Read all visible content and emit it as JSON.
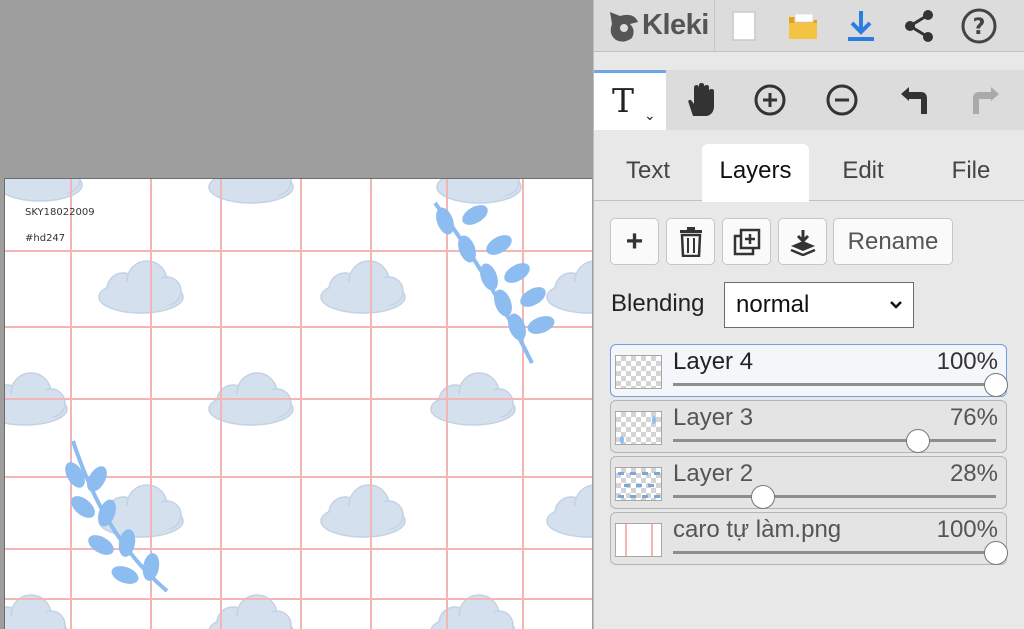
{
  "app": {
    "name": "Kleki"
  },
  "canvas": {
    "texts": [
      "SKY18022009",
      "#hd247"
    ]
  },
  "topbar": {
    "buttons": [
      "new-image",
      "open-file",
      "download",
      "share",
      "help"
    ]
  },
  "toolbar": {
    "active_tool_glyph": "T",
    "tools": [
      "text-tool",
      "hand-tool",
      "zoom-in",
      "zoom-out",
      "undo",
      "redo"
    ]
  },
  "tabs": [
    {
      "label": "Text",
      "active": false
    },
    {
      "label": "Layers",
      "active": true
    },
    {
      "label": "Edit",
      "active": false
    },
    {
      "label": "File",
      "active": false
    }
  ],
  "layer_actions": {
    "add": "+",
    "rename_label": "Rename"
  },
  "blending": {
    "label": "Blending",
    "value": "normal"
  },
  "layers": [
    {
      "name": "Layer 4",
      "opacity_label": "100%",
      "opacity": 1.0,
      "active": true
    },
    {
      "name": "Layer 3",
      "opacity_label": "76%",
      "opacity": 0.76,
      "active": false
    },
    {
      "name": "Layer 2",
      "opacity_label": "28%",
      "opacity": 0.28,
      "active": false
    },
    {
      "name": "caro tự làm.png",
      "opacity_label": "100%",
      "opacity": 1.0,
      "active": false
    }
  ],
  "colors": {
    "accent": "#2a7de1",
    "folder": "#f3b91d",
    "leaf": "#8cbcf0",
    "grid": "#f2b6b6",
    "cloud": "#d5e0ee"
  }
}
